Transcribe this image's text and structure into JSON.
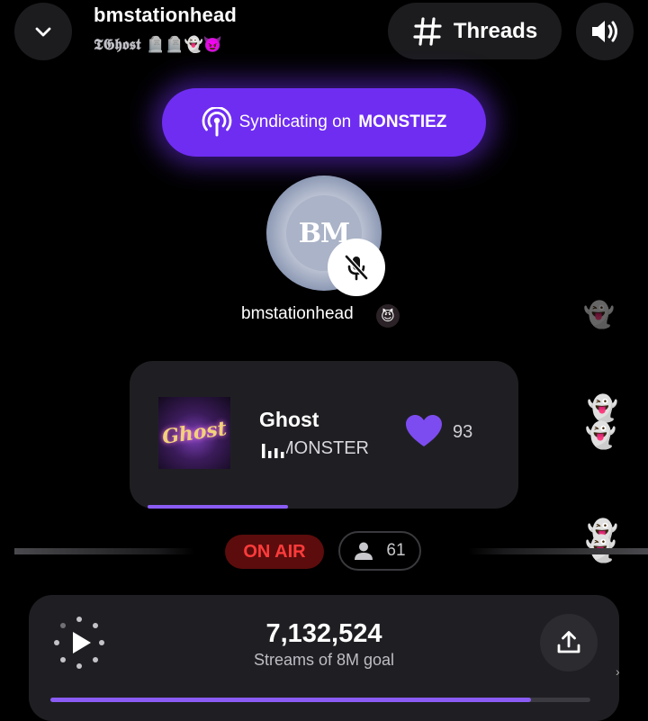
{
  "header": {
    "station_name": "bmstationhead",
    "station_subtitle": "𝕿𝕲𝖍𝖔𝖘𝖙 🪦🪦👻😈",
    "threads_label": "Threads",
    "back_icon": "chevron-down-icon",
    "sound_icon": "speaker-icon"
  },
  "syndication": {
    "prefix": "Syndicating on",
    "channel": "MONSTIEZ",
    "icon": "broadcast-icon",
    "accent_color": "#6f2df2"
  },
  "host": {
    "avatar_text": "BM",
    "name": "bmstationhead",
    "badge": "😈",
    "muted": true
  },
  "reactions": {
    "ghost": "👻"
  },
  "now_playing": {
    "title": "Ghost",
    "artist": "MONSTER",
    "album_art_text": "Ghost",
    "likes": "93",
    "progress": 0.38,
    "like_color": "#7d4cf0"
  },
  "status": {
    "on_air_label": "ON AIR",
    "listeners": "61",
    "on_air_color": "#ff3b3b"
  },
  "stream_goal": {
    "count": "7,132,524",
    "label": "Streams of 8M goal",
    "progress": 0.89
  },
  "edge_glyph": "›"
}
